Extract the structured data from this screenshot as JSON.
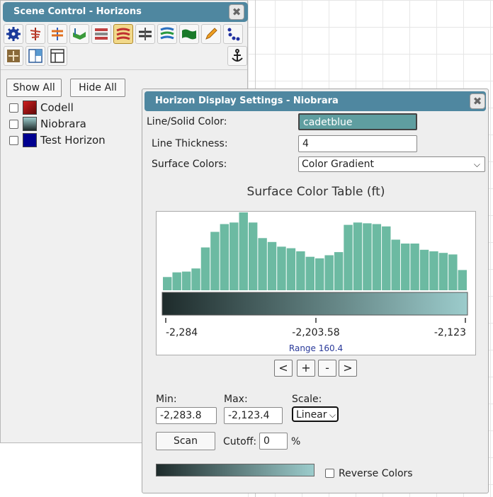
{
  "scene_panel": {
    "title": "Scene Control - Horizons",
    "show_all_label": "Show All",
    "hide_all_label": "Hide All",
    "horizons": [
      {
        "name": "Codell",
        "color": "#b01010",
        "checked": false
      },
      {
        "name": "Niobrara",
        "color": "#5f9ea0",
        "checked": false
      },
      {
        "name": "Test Horizon",
        "color": "#000090",
        "checked": false
      }
    ],
    "toolbar_icons": [
      "settings-gear-icon",
      "well-trajectory-icon",
      "well-markers-icon",
      "surface-icon",
      "grid-layers-icon",
      "horizons-icon",
      "fault-icon",
      "contours-icon",
      "map-surface-icon",
      "pencil-icon",
      "points-icon",
      "move-icon",
      "panel-layout-icon",
      "window-layout-icon",
      "anchor-icon"
    ]
  },
  "dialog": {
    "title": "Horizon Display Settings - Niobrara",
    "line_color_label": "Line/Solid Color:",
    "line_color_value": "cadetblue",
    "line_thickness_label": "Line Thickness:",
    "line_thickness_value": "4",
    "surface_colors_label": "Surface Colors:",
    "surface_colors_value": "Color Gradient",
    "nav_buttons": [
      "<",
      "+",
      "-",
      ">"
    ],
    "min_label": "Min:",
    "min_value": "-2,283.8",
    "max_label": "Max:",
    "max_value": "-2,123.4",
    "scale_label": "Scale:",
    "scale_value": "Linear",
    "scan_label": "Scan",
    "cutoff_label": "Cutoff:",
    "cutoff_value": "0",
    "cutoff_unit": "%",
    "reverse_colors_label": "Reverse Colors",
    "colors": {
      "gradient_start": "#1e2b2b",
      "gradient_end": "#9ccccc",
      "bar": "#6cbaa2"
    }
  },
  "chart_data": {
    "type": "bar",
    "title": "Surface Color Table (ft)",
    "tick_labels": [
      "-2,284",
      "-2,203.58",
      "-2,123"
    ],
    "range_label": "Range 160.4",
    "x_range": [
      -2284,
      -2123
    ],
    "values": [
      17,
      23,
      24,
      28,
      55,
      75,
      85,
      87,
      100,
      87,
      67,
      62,
      56,
      54,
      50,
      43,
      41,
      45,
      49,
      84,
      87,
      86,
      85,
      82,
      65,
      60,
      60,
      52,
      50,
      48,
      46,
      26
    ]
  }
}
